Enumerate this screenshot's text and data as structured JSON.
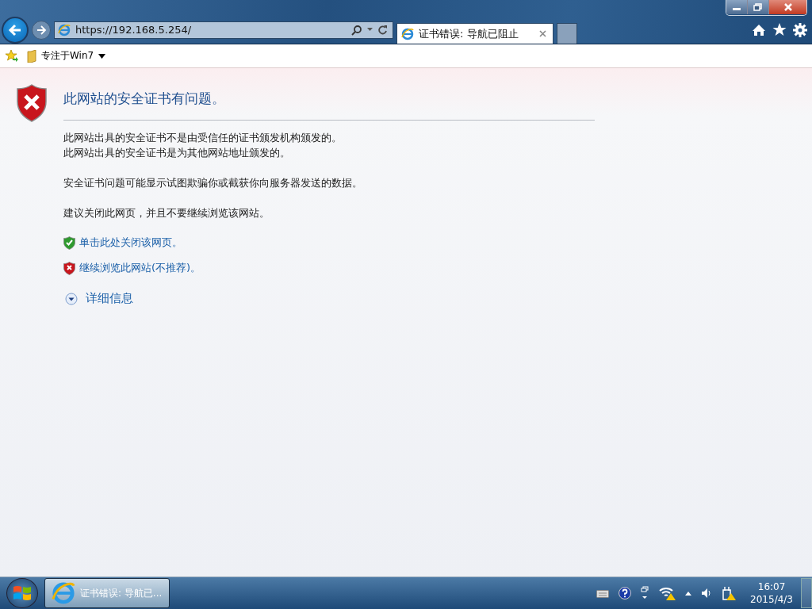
{
  "browser": {
    "address": "https://192.168.5.254/",
    "tab": {
      "title": "证书错误: 导航已阻止",
      "selected": true
    }
  },
  "favorites_bar": {
    "items": [
      {
        "label": "专注于Win7"
      }
    ]
  },
  "page": {
    "title": "此网站的安全证书有问题。",
    "paragraphs": [
      [
        "此网站出具的安全证书不是由受信任的证书颁发机构颁发的。",
        "此网站出具的安全证书是为其他网站地址颁发的。"
      ],
      [
        "安全证书问题可能显示试图欺骗你或截获你向服务器发送的数据。"
      ],
      [
        "建议关闭此网页，并且不要继续浏览该网站。"
      ]
    ],
    "links": [
      {
        "label": "单击此处关闭该网页。",
        "kind": "safe"
      },
      {
        "label": "继续浏览此网站(不推荐)。",
        "kind": "unsafe"
      }
    ],
    "details": {
      "label": "详细信息",
      "expanded": false
    }
  },
  "taskbar": {
    "windows": [
      {
        "label": "证书错误: 导航已...",
        "selected": true
      }
    ],
    "time": "16:07",
    "date": "2015/4/3"
  }
}
